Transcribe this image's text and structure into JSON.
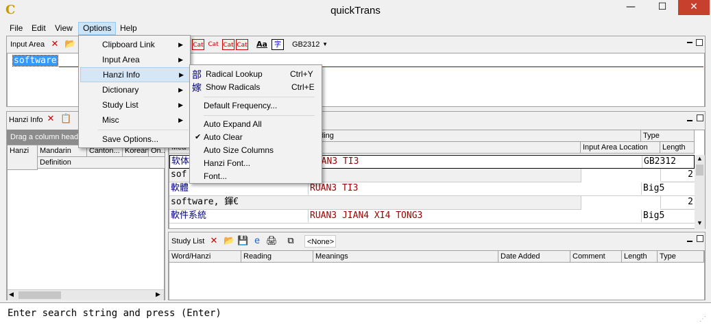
{
  "window": {
    "title": "quickTrans",
    "min": "—",
    "max": "☐",
    "close": "✕"
  },
  "menubar": {
    "file": "File",
    "edit": "Edit",
    "view": "View",
    "options": "Options",
    "help": "Help"
  },
  "input_area": {
    "label": "Input Area",
    "encoding": "GB2312",
    "text": "software",
    "cat_icons": [
      "Cat",
      "Cat",
      "Cat",
      "Cat"
    ],
    "aa": "Aa"
  },
  "hanzi_info": {
    "label": "Hanzi Info",
    "group_hint": "Drag a column heade",
    "cols": [
      "Hanzi",
      "Mandarin",
      "Canton...",
      "Korean",
      "On..."
    ],
    "definition_col": "Definition"
  },
  "results": {
    "header_reading": "ading",
    "header_type": "Type",
    "header_meaning": "Mea",
    "header_input_loc": "Input Area Location",
    "header_length": "Length",
    "rows": [
      {
        "hanzi": "软体",
        "reading": "RUAN3 TI3",
        "type": "GB2312",
        "meaning": "sof",
        "length": "2"
      },
      {
        "hanzi": "軟體",
        "reading": "RUAN3 TI3",
        "type": "Big5",
        "meaning": "software, 鍕€",
        "length": "2"
      },
      {
        "hanzi": "軟件系統",
        "reading": "RUAN3 JIAN4 XI4 TONG3",
        "type": "Big5",
        "meaning": "",
        "length": ""
      }
    ]
  },
  "study_list": {
    "label": "Study List",
    "selector": "<None>",
    "cols": [
      "Word/Hanzi",
      "Reading",
      "Meanings",
      "Date Added",
      "Comment",
      "Length",
      "Type"
    ]
  },
  "options_menu": {
    "items": [
      "Clipboard Link",
      "Input Area",
      "Hanzi Info",
      "Dictionary",
      "Study List",
      "Misc",
      "Save Options..."
    ]
  },
  "hanzi_submenu": {
    "radical_lookup": "Radical Lookup",
    "radical_lookup_shortcut": "Ctrl+Y",
    "show_radicals": "Show Radicals",
    "show_radicals_shortcut": "Ctrl+E",
    "default_frequency": "Default Frequency...",
    "auto_expand_all": "Auto Expand All",
    "auto_clear": "Auto Clear",
    "auto_size_columns": "Auto Size Columns",
    "hanzi_font": "Hanzi Font...",
    "font": "Font..."
  },
  "status": {
    "text": "Enter search string and press (Enter)"
  }
}
